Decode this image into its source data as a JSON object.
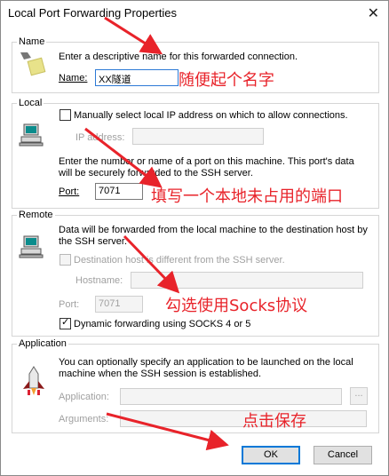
{
  "window": {
    "title": "Local Port Forwarding Properties",
    "close_glyph": "✕"
  },
  "name_group": {
    "label": "Name",
    "description": "Enter a descriptive name for this forwarded connection.",
    "name_label": "Name:",
    "name_value": "XX隧道",
    "icon": "tag-icon"
  },
  "local_group": {
    "label": "Local",
    "manual_ip_label": "Manually select local IP address on which to allow connections.",
    "ip_label": "IP address:",
    "description_line1": "Enter the number or name of a port on this machine.  This port's data",
    "description_line2": "will be securely forwarded to the SSH server.",
    "port_label": "Port:",
    "port_value": "7071",
    "icon": "computer-icon"
  },
  "remote_group": {
    "label": "Remote",
    "description_line1": "Data will be forwarded from the local machine to the destination host by",
    "description_line2": "the SSH server.",
    "dest_host_label": "Destination host is different from the SSH server.",
    "hostname_label": "Hostname:",
    "port_label": "Port:",
    "port_value": "7071",
    "dynamic_label": "Dynamic forwarding using SOCKS 4 or 5",
    "icon": "computer-icon"
  },
  "application_group": {
    "label": "Application",
    "description_line1": "You can optionally specify an application to be launched on the local",
    "description_line2": "machine when the SSH session is established.",
    "application_label": "Application:",
    "arguments_label": "Arguments:",
    "browse_label": "...",
    "icon": "rocket-icon"
  },
  "buttons": {
    "ok": "OK",
    "cancel": "Cancel"
  },
  "annotations": {
    "name": "随便起个名字",
    "port": "填写一个本地未占用的端口",
    "socks": "勾选使用Socks协议",
    "save": "点击保存"
  },
  "colors": {
    "annotation": "#e8232a",
    "default_button_border": "#0078d7"
  }
}
